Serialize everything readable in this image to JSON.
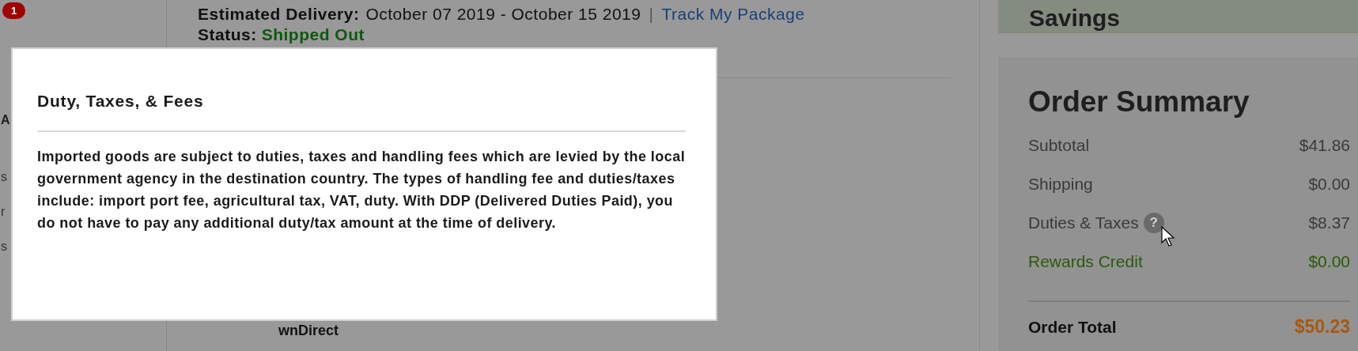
{
  "sidebar": {
    "badge": "1",
    "fragments": [
      "A",
      "s",
      "r",
      "s"
    ]
  },
  "order": {
    "delivery_label": "Estimated Delivery:",
    "delivery_dates": "October 07 2019 - October 15 2019",
    "separator": "|",
    "track_link": "Track My Package",
    "status_label": "Status:",
    "status_value": "Shipped Out",
    "carrier_fragment": "wnDirect"
  },
  "savings": {
    "title": "Savings"
  },
  "summary": {
    "title": "Order Summary",
    "help_label": "?",
    "rows": [
      {
        "label": "Subtotal",
        "value": "$41.86",
        "kind": "plain",
        "help": false
      },
      {
        "label": "Shipping",
        "value": "$0.00",
        "kind": "plain",
        "help": false
      },
      {
        "label": "Duties & Taxes",
        "value": "$8.37",
        "kind": "plain",
        "help": true
      },
      {
        "label": "Rewards Credit",
        "value": "$0.00",
        "kind": "credit",
        "help": false
      }
    ],
    "total_label": "Order Total",
    "total_value": "$50.23"
  },
  "modal": {
    "title": "Duty, Taxes, & Fees",
    "body": "Imported goods are subject to duties, taxes and handling fees which are levied by the local government agency in the destination country. The types of handling fee and duties/taxes include: import port fee, agricultural tax, VAT, duty. With DDP (Delivered Duties Paid), you do not have to pay any additional duty/tax amount at the time of delivery."
  }
}
